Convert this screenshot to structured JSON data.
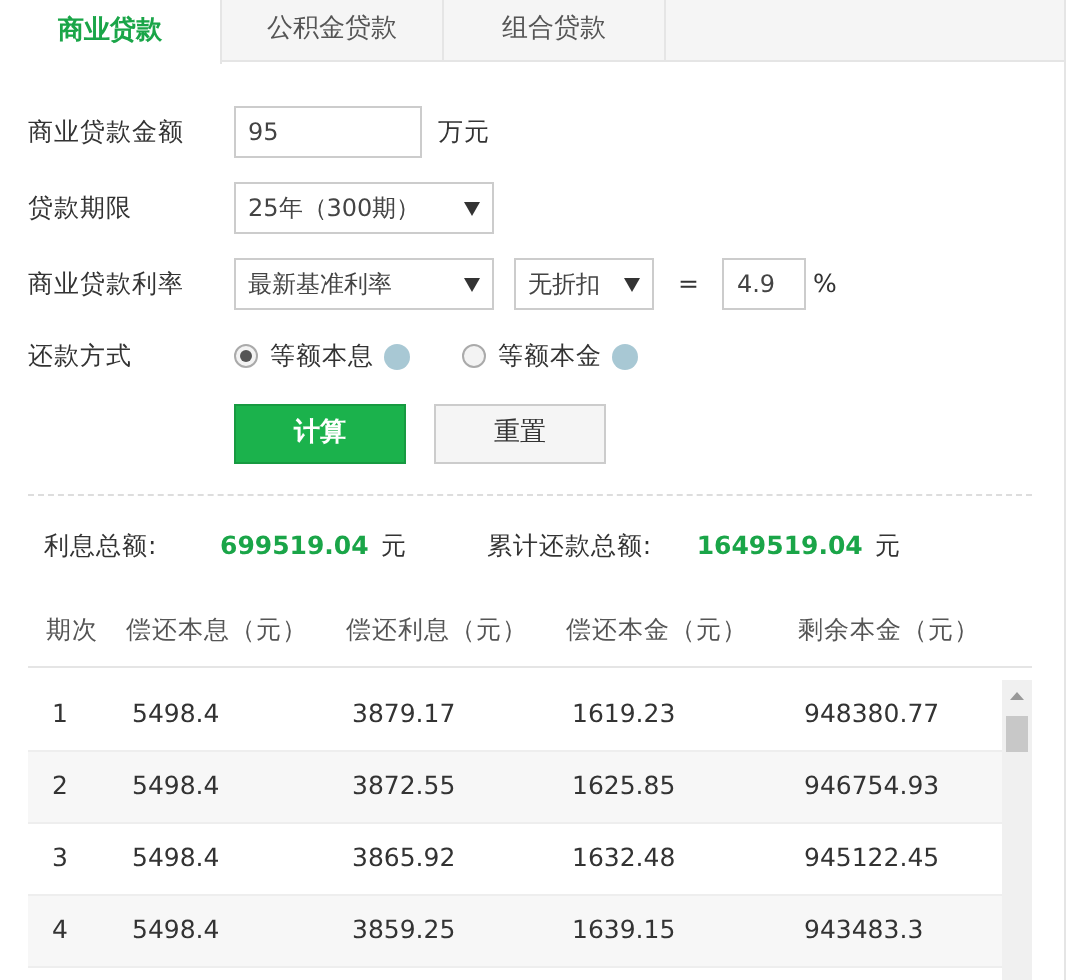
{
  "tabs": [
    {
      "label": "商业贷款",
      "selected": true
    },
    {
      "label": "公积金贷款",
      "selected": false
    },
    {
      "label": "组合贷款",
      "selected": false
    }
  ],
  "form": {
    "amount": {
      "label": "商业贷款金额",
      "value": "95",
      "unit": "万元"
    },
    "term": {
      "label": "贷款期限",
      "value": "25年（300期）"
    },
    "rate": {
      "label": "商业贷款利率",
      "base": "最新基准利率",
      "discount": "无折扣",
      "equals": "=",
      "value": "4.9",
      "unit": "%"
    },
    "method": {
      "label": "还款方式",
      "options": [
        {
          "label": "等额本息",
          "selected": true
        },
        {
          "label": "等额本金",
          "selected": false
        }
      ]
    },
    "buttons": [
      {
        "label": "计算",
        "kind": "primary"
      },
      {
        "label": "重置",
        "kind": "secondary"
      }
    ]
  },
  "summary": [
    {
      "label": "利息总额:",
      "value": "699519.04",
      "unit": "元"
    },
    {
      "label": "累计还款总额:",
      "value": "1649519.04",
      "unit": "元"
    }
  ],
  "table": {
    "columns": [
      "期次",
      "偿还本息（元）",
      "偿还利息（元）",
      "偿还本金（元）",
      "剩余本金（元）"
    ],
    "rows": [
      [
        "1",
        "5498.4",
        "3879.17",
        "1619.23",
        "948380.77"
      ],
      [
        "2",
        "5498.4",
        "3872.55",
        "1625.85",
        "946754.93"
      ],
      [
        "3",
        "5498.4",
        "3865.92",
        "1632.48",
        "945122.45"
      ],
      [
        "4",
        "5498.4",
        "3859.25",
        "1639.15",
        "943483.3"
      ]
    ]
  }
}
